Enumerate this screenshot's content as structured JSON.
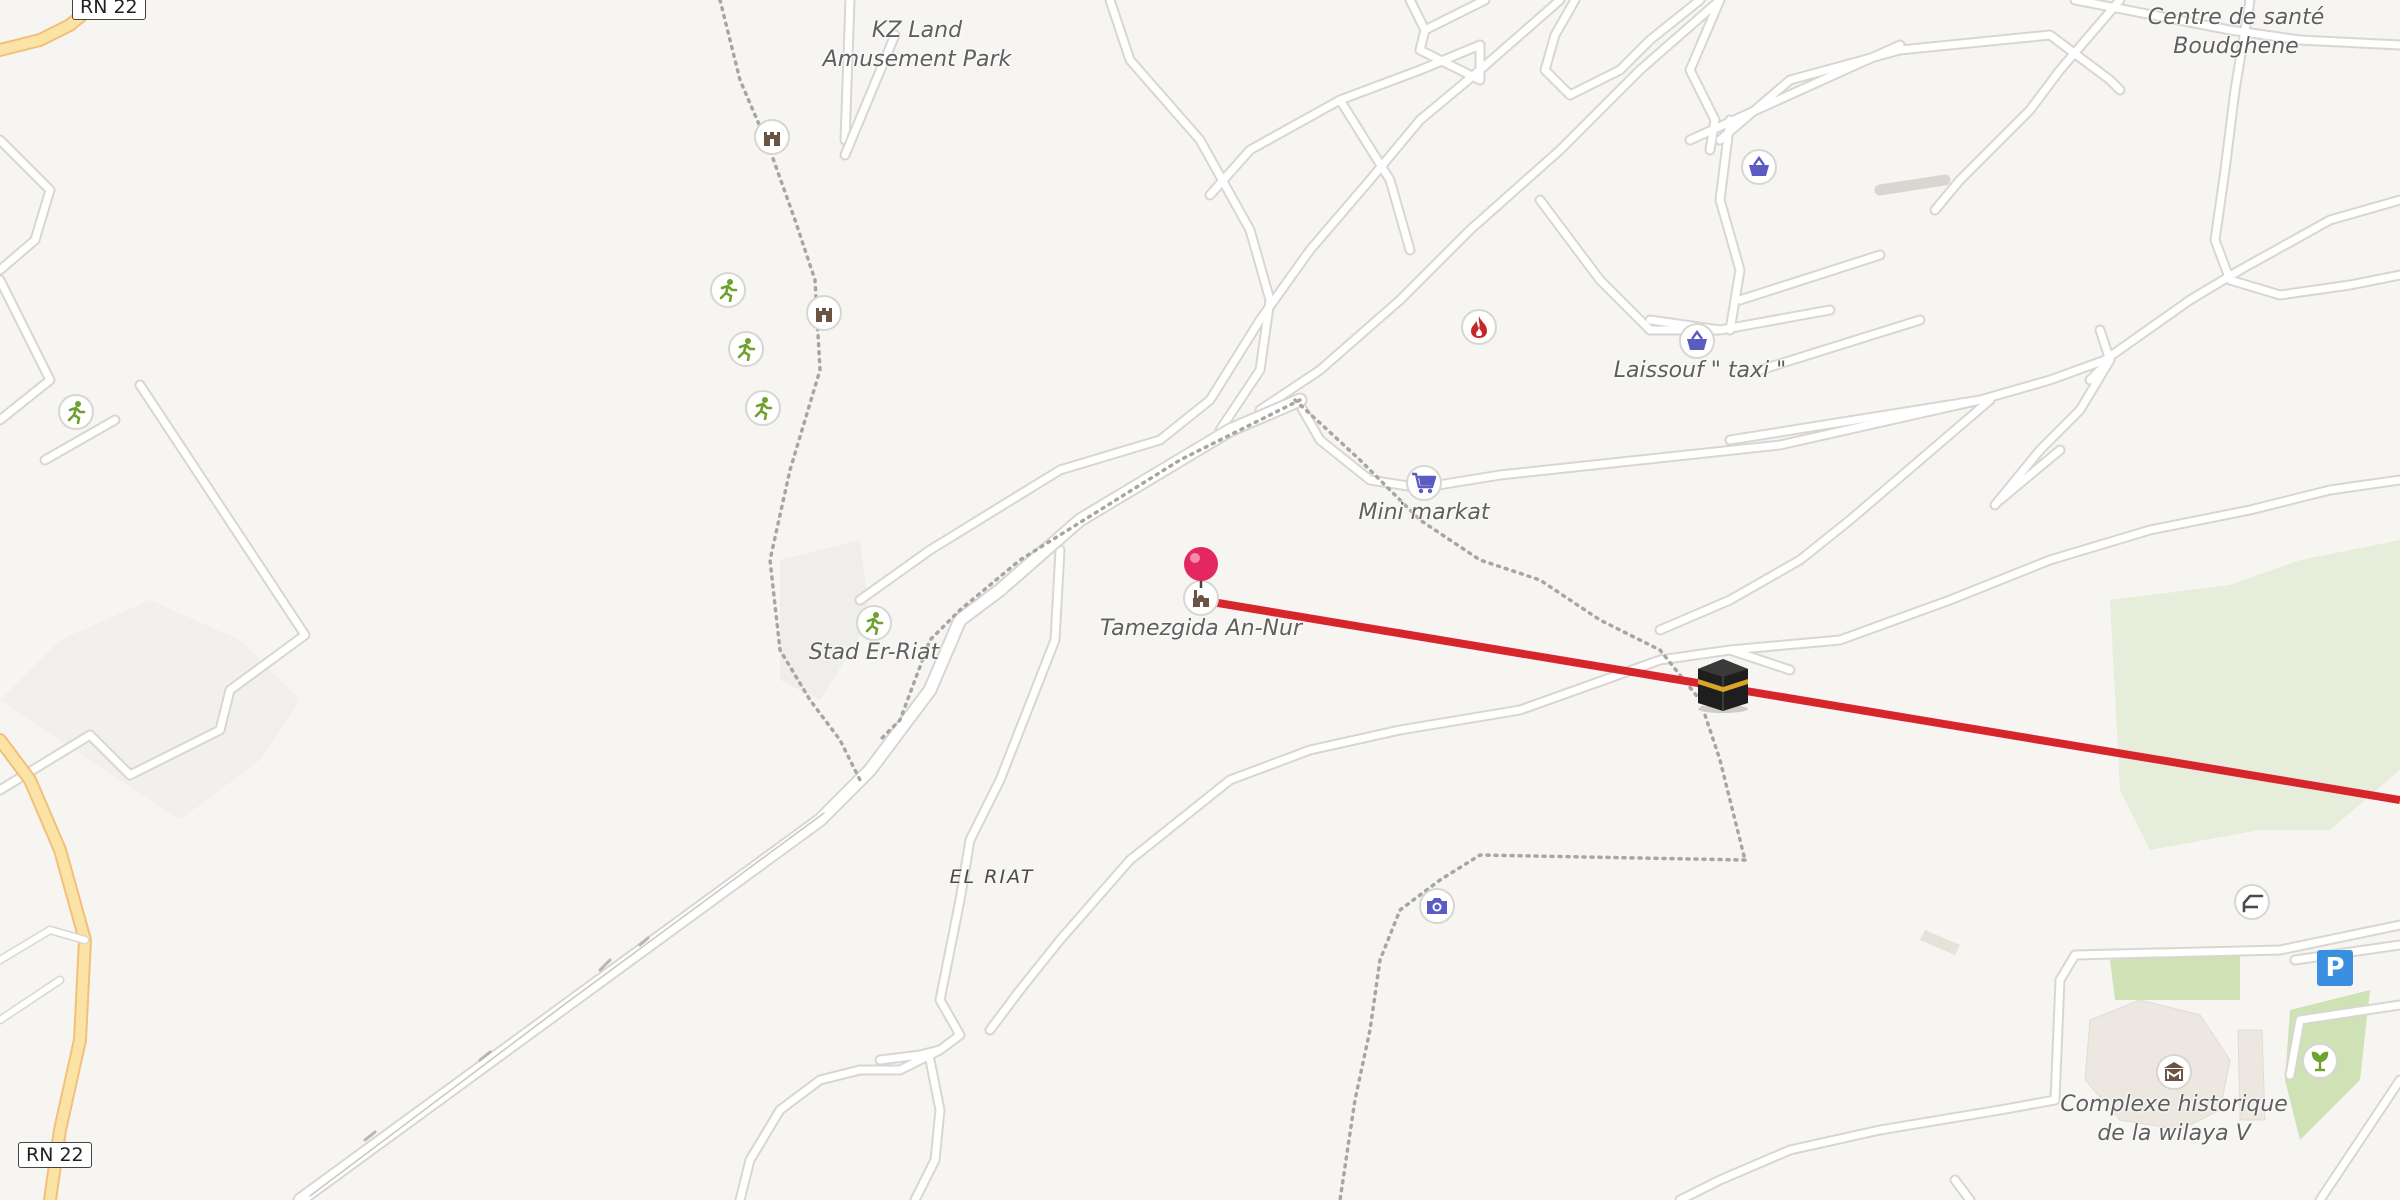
{
  "map": {
    "road_shields": [
      "RN 22",
      "RN 22"
    ],
    "place_labels": {
      "kz_land": [
        "KZ Land",
        "Amusement Park"
      ],
      "centre_sante": [
        "Centre de santé",
        "Boudghene"
      ],
      "laissouf_taxi": "Laissouf \" taxi \"",
      "mini_markat": "Mini markat",
      "tamezgida": "Tamezgida An-Nur",
      "stad": "Stad Er-Riat",
      "complexe": [
        "Complexe historique",
        "de la wilaya V"
      ]
    },
    "area_label": "EL RIAT",
    "parking_symbol": "P",
    "pois": [
      {
        "name": "castle-icon",
        "kind": "castle"
      },
      {
        "name": "castle-icon",
        "kind": "castle"
      },
      {
        "name": "sports-icon",
        "kind": "sports"
      },
      {
        "name": "sports-icon",
        "kind": "sports"
      },
      {
        "name": "sports-icon",
        "kind": "sports"
      },
      {
        "name": "sports-icon",
        "kind": "sports"
      },
      {
        "name": "sports-icon",
        "kind": "sports"
      },
      {
        "name": "shopping-basket-icon",
        "kind": "basket"
      },
      {
        "name": "shopping-basket-icon",
        "kind": "basket"
      },
      {
        "name": "fire-station-icon",
        "kind": "fire"
      },
      {
        "name": "shopping-cart-icon",
        "kind": "cart"
      },
      {
        "name": "mosque-icon",
        "kind": "mosque"
      },
      {
        "name": "camera-icon",
        "kind": "camera"
      },
      {
        "name": "museum-icon",
        "kind": "museum"
      },
      {
        "name": "garden-icon",
        "kind": "garden"
      },
      {
        "name": "viewpoint-icon",
        "kind": "viewpoint"
      }
    ],
    "markers": {
      "pin": "location-pin-icon",
      "kaaba": "kaaba-icon"
    },
    "colors": {
      "background": "#f7f5f2",
      "road": "#ffffff",
      "road_casing": "#d9d6d2",
      "primary_road": "#fbe2a5",
      "primary_casing": "#f2c07a",
      "qibla_line": "#d7252c",
      "pin": "#e5275f",
      "park": "#e6eedb",
      "poi_blue": "#5b5bc4",
      "poi_green": "#6fa030",
      "poi_red": "#c62828",
      "poi_brown": "#6b5443"
    }
  }
}
